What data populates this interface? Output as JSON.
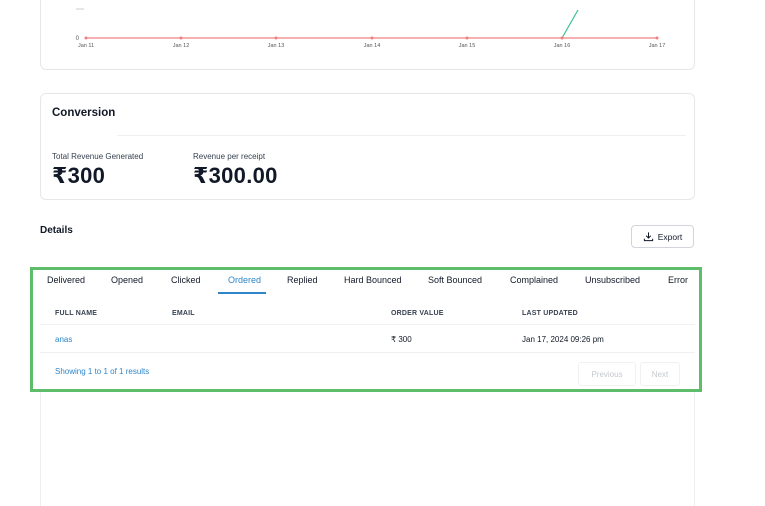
{
  "chart": {
    "y_tick_label": "0",
    "x_labels": [
      "Jan 11",
      "Jan 12",
      "Jan 13",
      "Jan 14",
      "Jan 15",
      "Jan 16",
      "Jan 17"
    ],
    "flat_series_color": "#f08080",
    "rising_series_color": "#34c38f"
  },
  "conversion": {
    "title": "Conversion",
    "metrics": [
      {
        "label": "Total Revenue Generated",
        "value": "₹300"
      },
      {
        "label": "Revenue per receipt",
        "value": "₹300.00"
      }
    ]
  },
  "details": {
    "title": "Details",
    "export_label": "Export",
    "tabs": [
      {
        "label": "Delivered"
      },
      {
        "label": "Opened"
      },
      {
        "label": "Clicked"
      },
      {
        "label": "Ordered"
      },
      {
        "label": "Replied"
      },
      {
        "label": "Hard Bounced"
      },
      {
        "label": "Soft Bounced"
      },
      {
        "label": "Complained"
      },
      {
        "label": "Unsubscribed"
      },
      {
        "label": "Error"
      }
    ],
    "active_tab": "Ordered",
    "table": {
      "headers": [
        "FULL NAME",
        "EMAIL",
        "ORDER VALUE",
        "LAST UPDATED"
      ],
      "rows": [
        {
          "full_name": "anas",
          "email": "",
          "order_value": "₹ 300",
          "last_updated": "Jan 17, 2024 09:26 pm"
        }
      ]
    },
    "pagination": {
      "showing_text": "Showing 1 to 1 of 1 results",
      "previous_label": "Previous",
      "next_label": "Next"
    },
    "highlight_color": "#5dbd6a",
    "accent_color": "#2e86c9"
  }
}
